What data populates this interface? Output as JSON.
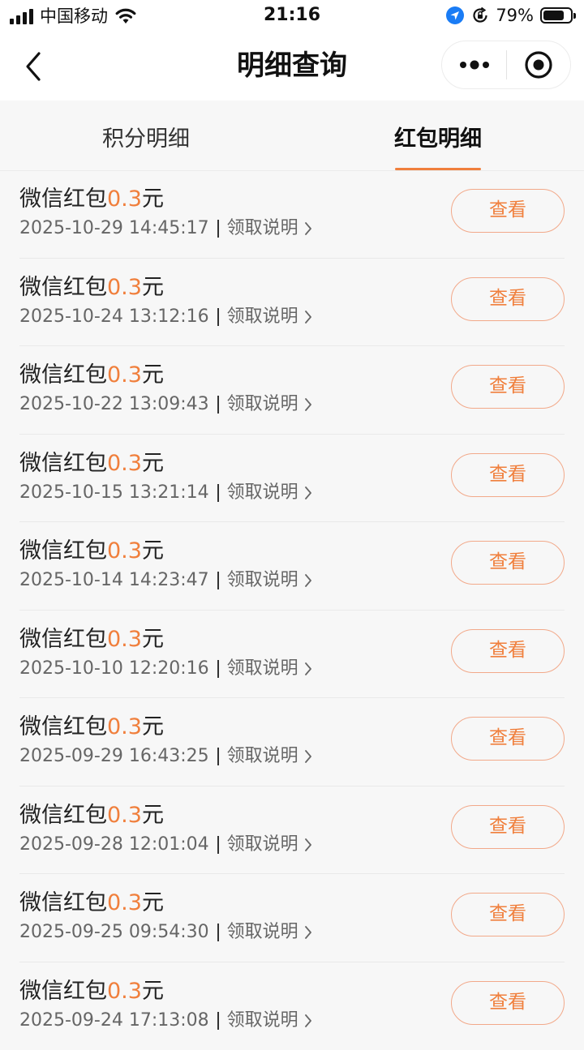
{
  "status_bar": {
    "carrier": "中国移动",
    "time": "21:16",
    "battery": "79%",
    "battery_level": 0.79
  },
  "nav": {
    "title": "明细查询"
  },
  "tabs": [
    {
      "label": "积分明细",
      "active": false
    },
    {
      "label": "红包明细",
      "active": true
    }
  ],
  "colors": {
    "accent": "#f07f3c",
    "button_border": "#f2a98a"
  },
  "records": [
    {
      "title": "微信红包",
      "amount": "0.3",
      "unit": "元",
      "datetime": "2025-10-29 14:45:17",
      "note": "领取说明",
      "action": "查看"
    },
    {
      "title": "微信红包",
      "amount": "0.3",
      "unit": "元",
      "datetime": "2025-10-24 13:12:16",
      "note": "领取说明",
      "action": "查看"
    },
    {
      "title": "微信红包",
      "amount": "0.3",
      "unit": "元",
      "datetime": "2025-10-22 13:09:43",
      "note": "领取说明",
      "action": "查看"
    },
    {
      "title": "微信红包",
      "amount": "0.3",
      "unit": "元",
      "datetime": "2025-10-15 13:21:14",
      "note": "领取说明",
      "action": "查看"
    },
    {
      "title": "微信红包",
      "amount": "0.3",
      "unit": "元",
      "datetime": "2025-10-14 14:23:47",
      "note": "领取说明",
      "action": "查看"
    },
    {
      "title": "微信红包",
      "amount": "0.3",
      "unit": "元",
      "datetime": "2025-10-10 12:20:16",
      "note": "领取说明",
      "action": "查看"
    },
    {
      "title": "微信红包",
      "amount": "0.3",
      "unit": "元",
      "datetime": "2025-09-29 16:43:25",
      "note": "领取说明",
      "action": "查看"
    },
    {
      "title": "微信红包",
      "amount": "0.3",
      "unit": "元",
      "datetime": "2025-09-28 12:01:04",
      "note": "领取说明",
      "action": "查看"
    },
    {
      "title": "微信红包",
      "amount": "0.3",
      "unit": "元",
      "datetime": "2025-09-25 09:54:30",
      "note": "领取说明",
      "action": "查看"
    },
    {
      "title": "微信红包",
      "amount": "0.3",
      "unit": "元",
      "datetime": "2025-09-24 17:13:08",
      "note": "领取说明",
      "action": "查看"
    }
  ]
}
